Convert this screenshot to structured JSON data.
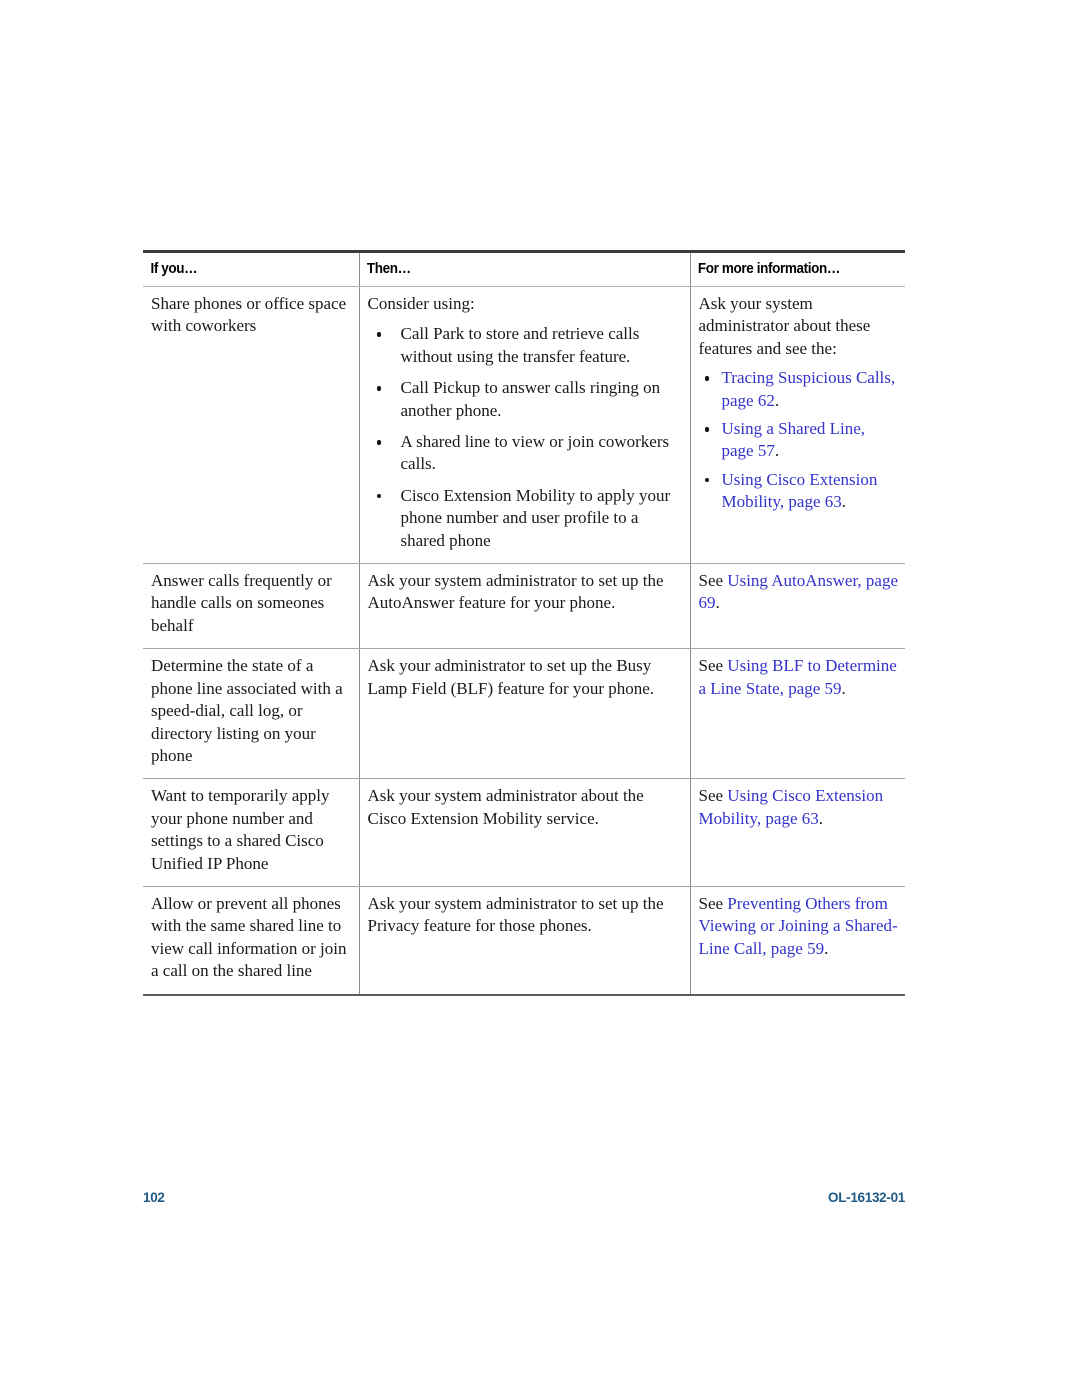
{
  "table": {
    "headers": [
      "If you…",
      "Then…",
      "For more information…"
    ],
    "rows": [
      {
        "if_you": "Share phones or office space with coworkers",
        "then_intro": "Consider using:",
        "then_bullets": [
          "Call Park to store and retrieve calls without using the transfer feature.",
          "Call Pickup to answer calls ringing on another phone.",
          "A shared line to view or join coworkers calls.",
          "Cisco Extension Mobility to apply your phone number and user profile to a shared phone"
        ],
        "info_intro": "Ask your system administrator about these features and see the:",
        "info_bullets": [
          {
            "link": "Tracing Suspicious Calls, page 62",
            "tail": "."
          },
          {
            "link": "Using a Shared Line, page 57",
            "tail": "."
          },
          {
            "link": "Using Cisco Extension Mobility, page 63",
            "tail": "."
          }
        ]
      },
      {
        "if_you": "Answer calls frequently or handle calls on someones behalf",
        "then": "Ask your system administrator to set up the AutoAnswer feature for your phone.",
        "info_lead": "See ",
        "info_link": "Using AutoAnswer, page 69",
        "info_tail": "."
      },
      {
        "if_you": "Determine the state of a phone line associated with a speed-dial, call log, or directory listing on your phone",
        "then": "Ask your administrator to set up the Busy Lamp Field (BLF) feature for your phone.",
        "info_lead": "See ",
        "info_link": "Using BLF to Determine a Line State, page 59",
        "info_tail": "."
      },
      {
        "if_you": "Want to temporarily apply your phone number and settings to a shared Cisco Unified IP Phone",
        "then": "Ask your system administrator about the Cisco Extension Mobility service.",
        "info_lead": "See ",
        "info_link": "Using Cisco Extension Mobility, page 63",
        "info_tail": "."
      },
      {
        "if_you": "Allow or prevent all phones with the same shared line to view call information or join a call on the shared line",
        "then": "Ask your system administrator to set up the Privacy feature for those phones.",
        "info_lead": "See ",
        "info_link": "Preventing Others from Viewing or Joining a Shared-Line Call, page 59",
        "info_tail": "."
      }
    ]
  },
  "footer": {
    "page_number": "102",
    "document_id": "OL-16132-01"
  },
  "colors": {
    "xref_blue": "#3333cc",
    "footer_blue": "#205a86",
    "rule_dark": "#3b3b3b",
    "rule_light": "#a8a8a8"
  }
}
